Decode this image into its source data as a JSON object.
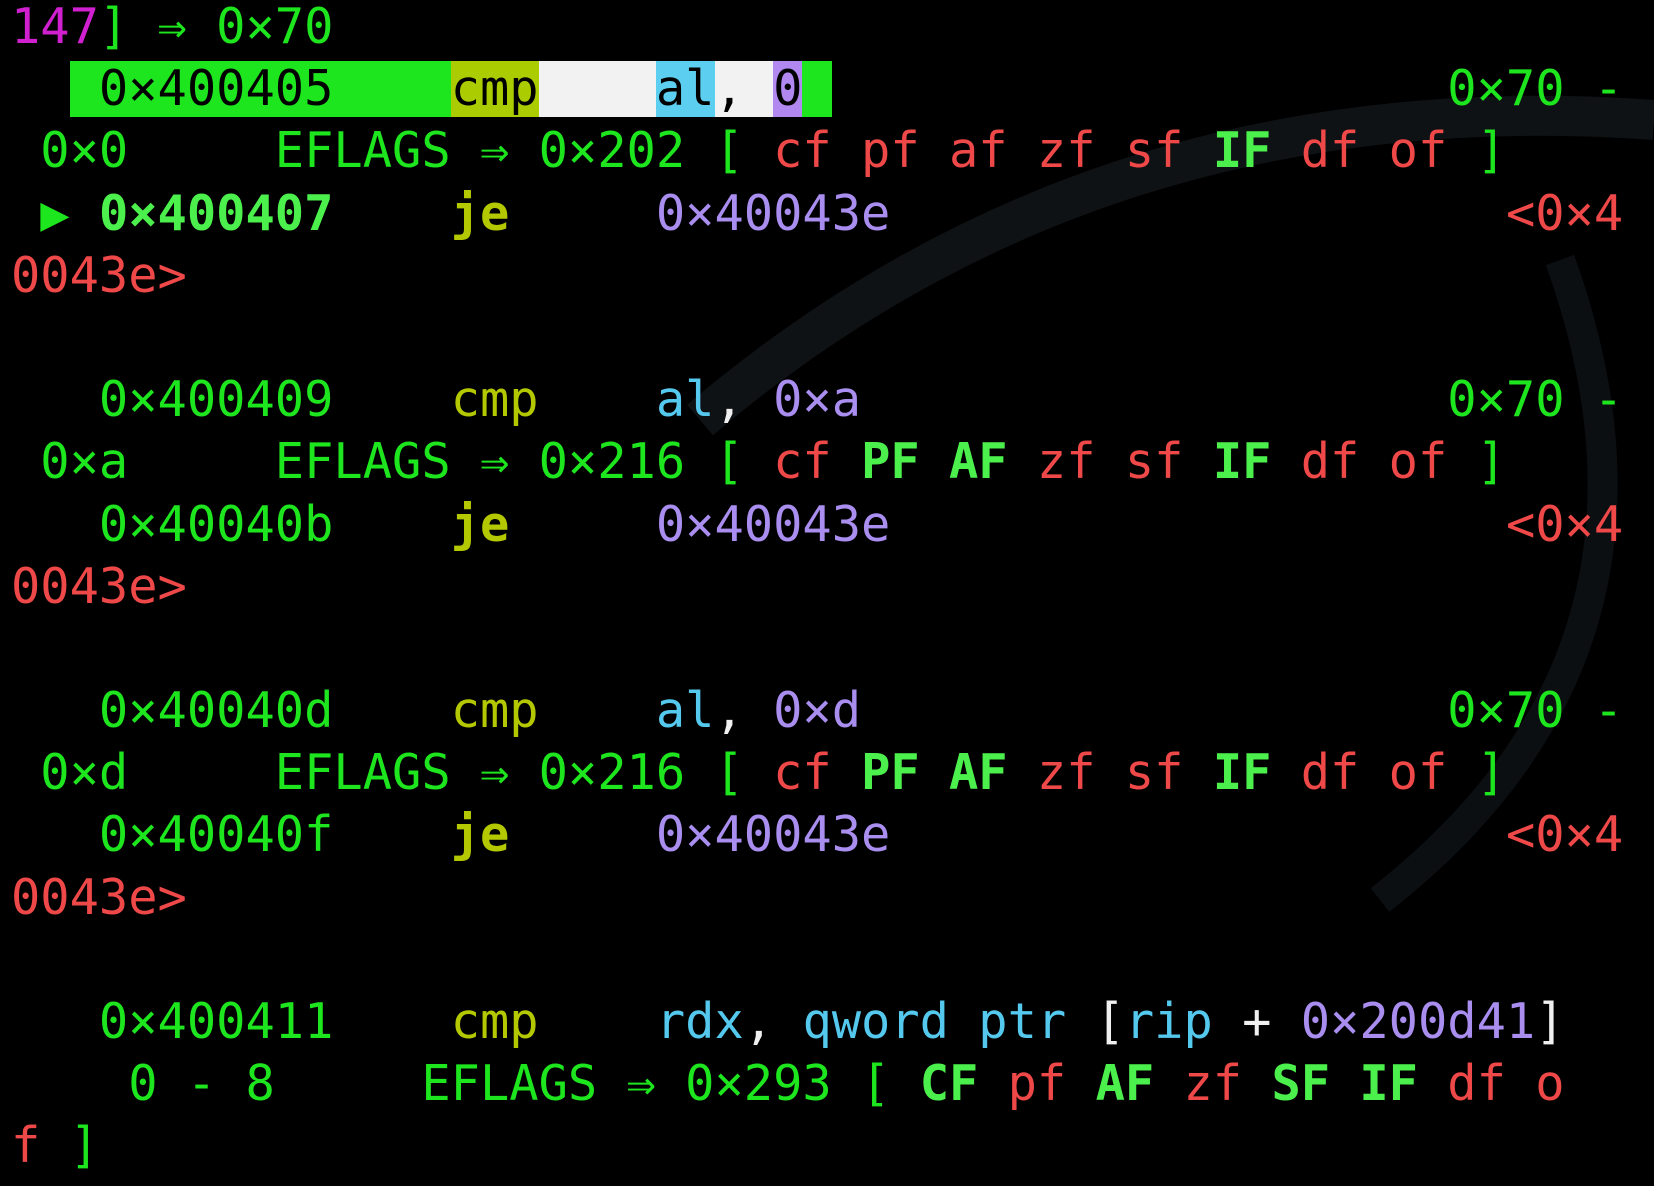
{
  "lines": [
    {
      "segs": [
        {
          "t": "147",
          "c": "magenta"
        },
        {
          "t": "] ⇒ 0×70",
          "c": "green"
        }
      ]
    },
    {
      "segs": [
        {
          "t": "  ",
          "c": "green"
        },
        {
          "t": " 0×400405    ",
          "c": "hl-green"
        },
        {
          "t": "cmp",
          "c": "hl-olive"
        },
        {
          "t": "    ",
          "c": "hl-white"
        },
        {
          "t": "al",
          "c": "hl-cyan"
        },
        {
          "t": ", ",
          "c": "hl-white"
        },
        {
          "t": "0",
          "c": "hl-purple"
        },
        {
          "t": " ",
          "c": "hl-green"
        },
        {
          "t": "                     0×70 -",
          "c": "green"
        }
      ]
    },
    {
      "segs": [
        {
          "t": " 0×0     EFLAGS ⇒ 0×202 [ ",
          "c": "green"
        },
        {
          "t": "cf pf af zf sf ",
          "c": "red"
        },
        {
          "t": "IF",
          "c": "bgreen"
        },
        {
          "t": " df of",
          "c": "red"
        },
        {
          "t": " ]",
          "c": "green"
        }
      ]
    },
    {
      "segs": [
        {
          "t": " ▶ ",
          "c": "green"
        },
        {
          "t": "0×400407",
          "c": "bgreen"
        },
        {
          "t": "    ",
          "c": "green"
        },
        {
          "t": "je",
          "c": "bolive"
        },
        {
          "t": "     ",
          "c": "green"
        },
        {
          "t": "0×40043e",
          "c": "purple"
        },
        {
          "t": "                     ",
          "c": "green"
        },
        {
          "t": "<0×4",
          "c": "red"
        }
      ]
    },
    {
      "segs": [
        {
          "t": "0043e>",
          "c": "red"
        }
      ]
    },
    {
      "segs": [
        {
          "t": " ",
          "c": "green"
        }
      ]
    },
    {
      "segs": [
        {
          "t": "   0×400409    ",
          "c": "green"
        },
        {
          "t": "cmp",
          "c": "olive"
        },
        {
          "t": "    ",
          "c": "green"
        },
        {
          "t": "al",
          "c": "cyan"
        },
        {
          "t": ", ",
          "c": "white"
        },
        {
          "t": "0×a",
          "c": "purple"
        },
        {
          "t": "                    0×70 -",
          "c": "green"
        }
      ]
    },
    {
      "segs": [
        {
          "t": " 0×a     EFLAGS ⇒ 0×216 [ ",
          "c": "green"
        },
        {
          "t": "cf ",
          "c": "red"
        },
        {
          "t": "PF AF",
          "c": "bgreen"
        },
        {
          "t": " zf sf ",
          "c": "red"
        },
        {
          "t": "IF",
          "c": "bgreen"
        },
        {
          "t": " df of",
          "c": "red"
        },
        {
          "t": " ]",
          "c": "green"
        }
      ]
    },
    {
      "segs": [
        {
          "t": "   0×40040b    ",
          "c": "green"
        },
        {
          "t": "je",
          "c": "bolive"
        },
        {
          "t": "     ",
          "c": "green"
        },
        {
          "t": "0×40043e",
          "c": "purple"
        },
        {
          "t": "                     ",
          "c": "green"
        },
        {
          "t": "<0×4",
          "c": "red"
        }
      ]
    },
    {
      "segs": [
        {
          "t": "0043e>",
          "c": "red"
        }
      ]
    },
    {
      "segs": [
        {
          "t": " ",
          "c": "green"
        }
      ]
    },
    {
      "segs": [
        {
          "t": "   0×40040d    ",
          "c": "green"
        },
        {
          "t": "cmp",
          "c": "olive"
        },
        {
          "t": "    ",
          "c": "green"
        },
        {
          "t": "al",
          "c": "cyan"
        },
        {
          "t": ", ",
          "c": "white"
        },
        {
          "t": "0×d",
          "c": "purple"
        },
        {
          "t": "                    0×70 -",
          "c": "green"
        }
      ]
    },
    {
      "segs": [
        {
          "t": " 0×d     EFLAGS ⇒ 0×216 [ ",
          "c": "green"
        },
        {
          "t": "cf ",
          "c": "red"
        },
        {
          "t": "PF AF",
          "c": "bgreen"
        },
        {
          "t": " zf sf ",
          "c": "red"
        },
        {
          "t": "IF",
          "c": "bgreen"
        },
        {
          "t": " df of",
          "c": "red"
        },
        {
          "t": " ]",
          "c": "green"
        }
      ]
    },
    {
      "segs": [
        {
          "t": "   0×40040f    ",
          "c": "green"
        },
        {
          "t": "je",
          "c": "bolive"
        },
        {
          "t": "     ",
          "c": "green"
        },
        {
          "t": "0×40043e",
          "c": "purple"
        },
        {
          "t": "                     ",
          "c": "green"
        },
        {
          "t": "<0×4",
          "c": "red"
        }
      ]
    },
    {
      "segs": [
        {
          "t": "0043e>",
          "c": "red"
        }
      ]
    },
    {
      "segs": [
        {
          "t": " ",
          "c": "green"
        }
      ]
    },
    {
      "segs": [
        {
          "t": "   0×400411    ",
          "c": "green"
        },
        {
          "t": "cmp",
          "c": "olive"
        },
        {
          "t": "    ",
          "c": "green"
        },
        {
          "t": "rdx",
          "c": "cyan"
        },
        {
          "t": ", ",
          "c": "white"
        },
        {
          "t": "qword ptr ",
          "c": "cyan"
        },
        {
          "t": "[",
          "c": "white"
        },
        {
          "t": "rip",
          "c": "cyan"
        },
        {
          "t": " + ",
          "c": "white"
        },
        {
          "t": "0×200d41",
          "c": "purple"
        },
        {
          "t": "]",
          "c": "white"
        }
      ]
    },
    {
      "segs": [
        {
          "t": "    0 - 8     EFLAGS ⇒ 0×293 [ ",
          "c": "green"
        },
        {
          "t": "CF",
          "c": "bgreen"
        },
        {
          "t": " pf ",
          "c": "red"
        },
        {
          "t": "AF",
          "c": "bgreen"
        },
        {
          "t": " zf ",
          "c": "red"
        },
        {
          "t": "SF IF",
          "c": "bgreen"
        },
        {
          "t": " df o",
          "c": "red"
        }
      ]
    },
    {
      "segs": [
        {
          "t": "f",
          "c": "red"
        },
        {
          "t": " ]",
          "c": "green"
        }
      ]
    }
  ]
}
